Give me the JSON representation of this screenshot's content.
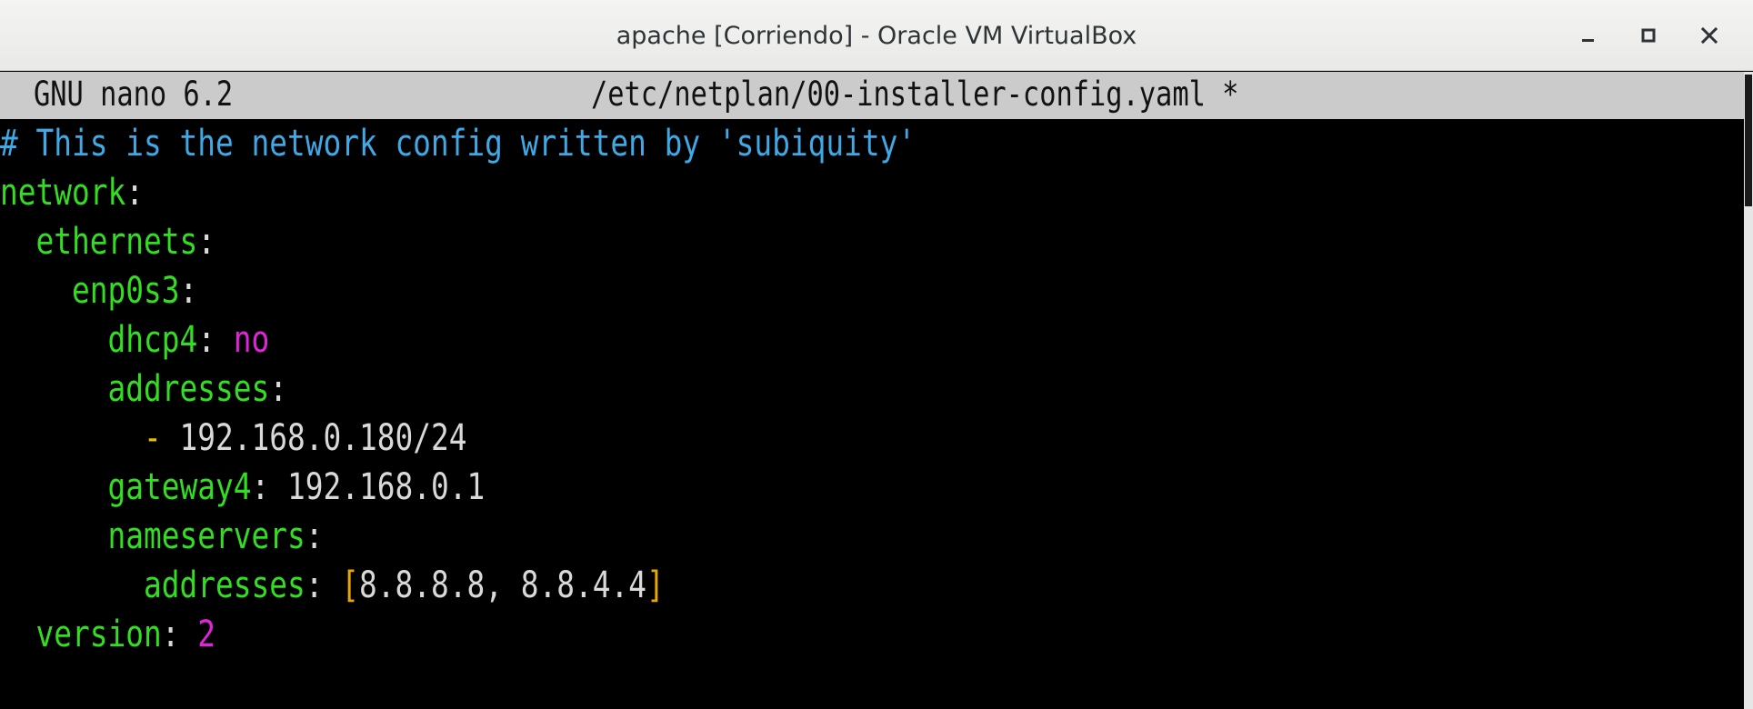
{
  "window": {
    "title": "apache [Corriendo] - Oracle VM VirtualBox",
    "buttons": {
      "minimize_icon": "minimize-icon",
      "maximize_icon": "maximize-icon",
      "close_icon": "close-icon"
    }
  },
  "nano": {
    "version": "GNU nano 6.2",
    "filename": "/etc/netplan/00-installer-config.yaml *"
  },
  "editor": {
    "comment": "# This is the network config written by 'subiquity'",
    "network_key": "network",
    "ethernets_key": "ethernets",
    "iface_key": "enp0s3",
    "dhcp4_key": "dhcp4",
    "dhcp4_value": "no",
    "addresses_key": "addresses",
    "address_dash": "-",
    "address_value": "192.168.0.180/24",
    "gateway_key": "gateway4",
    "gateway_value": "192.168.0.1",
    "nameservers_key": "nameservers",
    "ns_addresses_key": "addresses",
    "ns_open_bracket": "[",
    "ns_values": "8.8.8.8, 8.8.4.4",
    "ns_close_bracket": "]",
    "version_key": "version",
    "version_value": "2",
    "colon": ":"
  },
  "colors": {
    "comment": "#3fa9e6",
    "key": "#33dd22",
    "value": "#d9d9d9",
    "magenta": "#e024d8",
    "dash": "#e8c000",
    "bracket": "#e8a800",
    "header_bg": "#cbcbcb"
  }
}
